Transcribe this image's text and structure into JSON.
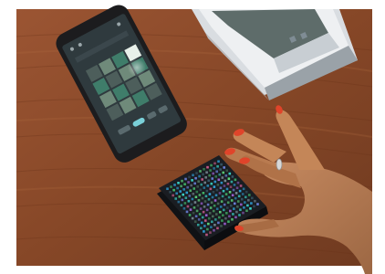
{
  "scene": {
    "colors": {
      "frame": "#ffffff",
      "table_wood": "#8a4a2a",
      "phone_body": "#1c1c1e",
      "phone_screen": "#2f3a3e",
      "pad_body": "#1a1d22",
      "nail_polish": "#e0442a",
      "book_cover": "#5e6c6a"
    },
    "icons": [
      "smartphone",
      "led-grid-controller",
      "book-stack",
      "hand"
    ]
  }
}
